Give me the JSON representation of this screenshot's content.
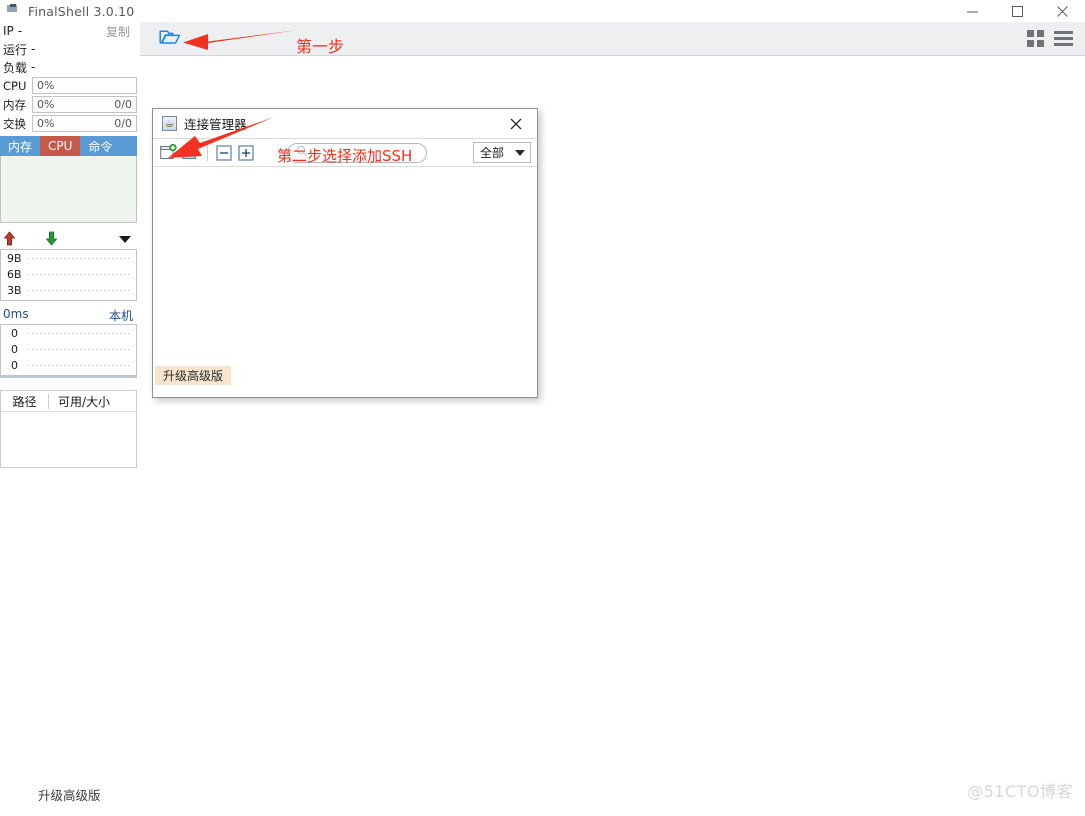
{
  "window": {
    "title": "FinalShell 3.0.10",
    "app_icon": "monitor-icon",
    "minimize_label": "—",
    "maximize_label": "□",
    "close_label": "✕"
  },
  "toolbar": {
    "open_folder_icon": "open-folder-icon",
    "grid_icon": "grid-view-icon",
    "menu_icon": "hamburger-menu-icon"
  },
  "sidebar": {
    "info": [
      {
        "key": "IP",
        "value": "-",
        "copy": "复制"
      },
      {
        "key": "运行",
        "value": "-"
      },
      {
        "key": "负载",
        "value": "-"
      }
    ],
    "meters": [
      {
        "label": "CPU",
        "percent": "0%",
        "detail": ""
      },
      {
        "label": "内存",
        "percent": "0%",
        "detail": "0/0"
      },
      {
        "label": "交换",
        "percent": "0%",
        "detail": "0/0"
      }
    ],
    "tabs": [
      {
        "label": "内存",
        "active": false
      },
      {
        "label": "CPU",
        "active": true
      },
      {
        "label": "命令",
        "active": false
      }
    ],
    "network": {
      "up_icon": "upload-arrow-icon",
      "down_icon": "download-arrow-icon",
      "expand_icon": "caret-down-icon",
      "y_labels": [
        "9B",
        "6B",
        "3B"
      ]
    },
    "ping": {
      "latency": "0ms",
      "host": "本机",
      "y_labels": [
        "0",
        "0",
        "0"
      ]
    },
    "disk": {
      "col_path": "路径",
      "col_avail": "可用/大小"
    },
    "upgrade_label": "升级高级版"
  },
  "dialog": {
    "title": "连接管理器",
    "app_icon": "java-coffee-icon",
    "close_label": "✕",
    "toolbar": [
      {
        "name": "new-connection-icon",
        "tip": ""
      },
      {
        "name": "new-folder-icon",
        "tip": ""
      },
      {
        "name": "collapse-all-icon",
        "tip": ""
      },
      {
        "name": "expand-all-icon",
        "tip": ""
      }
    ],
    "search": {
      "value": "",
      "placeholder": "",
      "icon": "search-icon"
    },
    "filter": {
      "selected": "全部",
      "options": [
        "全部"
      ]
    },
    "upgrade_label": "升级高级版"
  },
  "annotations": {
    "step1": "第一步",
    "step2": "第二步选择添加SSH",
    "arrow_color": "#f03222"
  },
  "watermark": "@51CTO博客",
  "colors": {
    "accent_blue": "#1e88e5",
    "tab_blue": "#5b9bd5",
    "tab_active": "#c55a4a",
    "toolbar_bg": "#edeff1",
    "annotation_red": "#ff2a1a"
  }
}
